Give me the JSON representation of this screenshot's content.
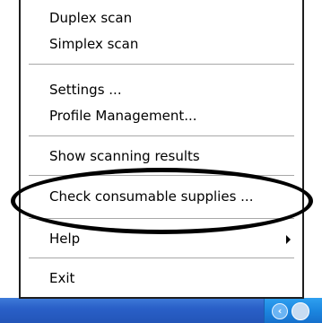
{
  "menu": {
    "items": [
      {
        "label": "Duplex scan"
      },
      {
        "label": "Simplex scan"
      },
      {
        "label": "Settings ..."
      },
      {
        "label": "Profile Management..."
      },
      {
        "label": "Show scanning results"
      },
      {
        "label": "Check consumable supplies ..."
      },
      {
        "label": "Help",
        "has_submenu": true
      },
      {
        "label": "Exit"
      }
    ]
  },
  "icons": {
    "tray_expand": "chevron-left-icon",
    "tray_app": "scanner-app-icon",
    "submenu": "caret-right-icon"
  },
  "colors": {
    "menu_background": "#ffffff",
    "taskbar": "#2a60c8",
    "tray": "#1c87e0",
    "highlight_ellipse": "#000000"
  }
}
